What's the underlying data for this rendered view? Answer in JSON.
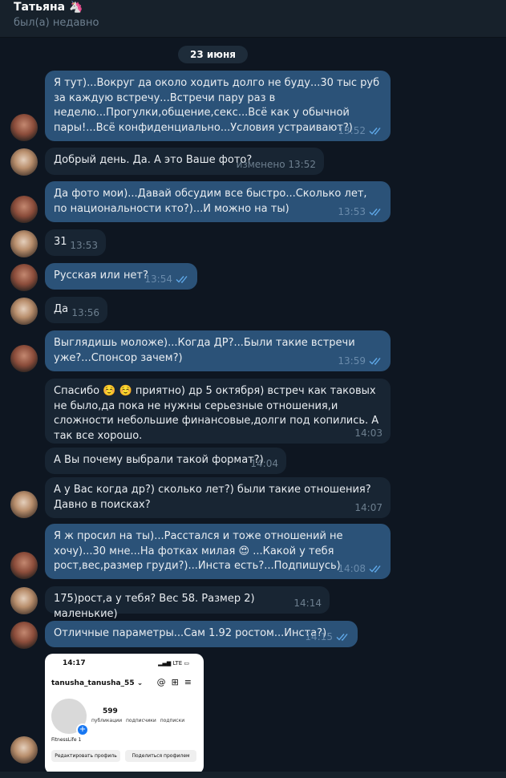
{
  "header": {
    "contact_name": "Татьяна",
    "emoji_icon": "unicorn-icon",
    "status": "был(а) недавно"
  },
  "chat": {
    "date_label": "23 июня",
    "messages": [
      {
        "dir": "out",
        "text": "Я тут)...Вокруг да около ходить долго не буду...30 тыс руб за каждую встречу...Встречи пару раз в неделю...Прогулки,общение,секс...Всё как у обычной пары!...Всё конфиденциально...Условия устраивают?)",
        "time": "13:52",
        "read": true
      },
      {
        "dir": "in",
        "text": "Добрый день. Да. А это Ваше фото?",
        "time": "изменено 13:52"
      },
      {
        "dir": "out",
        "text": "Да фото мои)...Давай обсудим все быстро...Сколько лет, по национальности кто?)...И можно на ты)",
        "time": "13:53",
        "read": true
      },
      {
        "dir": "in",
        "text": "31",
        "time": "13:53"
      },
      {
        "dir": "out",
        "text": "Русская или нет?",
        "time": "13:54",
        "read": true
      },
      {
        "dir": "in",
        "text": "Да",
        "time": "13:56"
      },
      {
        "dir": "out",
        "text": "Выглядишь моложе)...Когда ДР?...Были такие встречи уже?...Спонсор зачем?)",
        "time": "13:59",
        "read": true
      },
      {
        "dir": "in",
        "text": "Спасибо ☺️ ☺️ приятно) др 5 октября) встреч как таковых не было,да пока не нужны серьезные отношения,и сложности небольшие финансовые,долги под копились. А так все хорошо.",
        "time": "14:03"
      },
      {
        "dir": "in",
        "text": "А Вы почему выбрали такой формат?)",
        "time": "14:04"
      },
      {
        "dir": "in",
        "text": "А у Вас когда др?) сколько лет?) были такие отношения? Давно в поисках?",
        "time": "14:07"
      },
      {
        "dir": "out",
        "text": "Я ж просил на ты)...Расстался и тоже отношений не хочу)...30 мне...На фотках милая 😍 ...Какой у тебя рост,вес,размер груди?)...Инста есть?...Подпишусь)",
        "time": "14:08",
        "read": true
      },
      {
        "dir": "in",
        "text": "175)рост,а у тебя? Вес 58. Размер 2) маленькие)",
        "time": "14:14"
      },
      {
        "dir": "out",
        "text": "Отличные параметры...Сам 1.92 ростом...Инста?)",
        "time": "14:15",
        "read": true
      }
    ]
  },
  "screenshot": {
    "time": "14:17",
    "system": "LTE",
    "username": "tanusha_tanusha_55",
    "posts_count": "599",
    "labels": "публикации подписчики подписки",
    "bio": "FitnessLife",
    "bio_suffix": "1",
    "edit_profile": "Редактировать профиль",
    "share_profile": "Поделиться профилем"
  },
  "colors": {
    "background": "#0e1621",
    "outgoing_bubble": "#2b5278",
    "incoming_bubble": "#182533",
    "read_tick": "#5fa8e8"
  }
}
